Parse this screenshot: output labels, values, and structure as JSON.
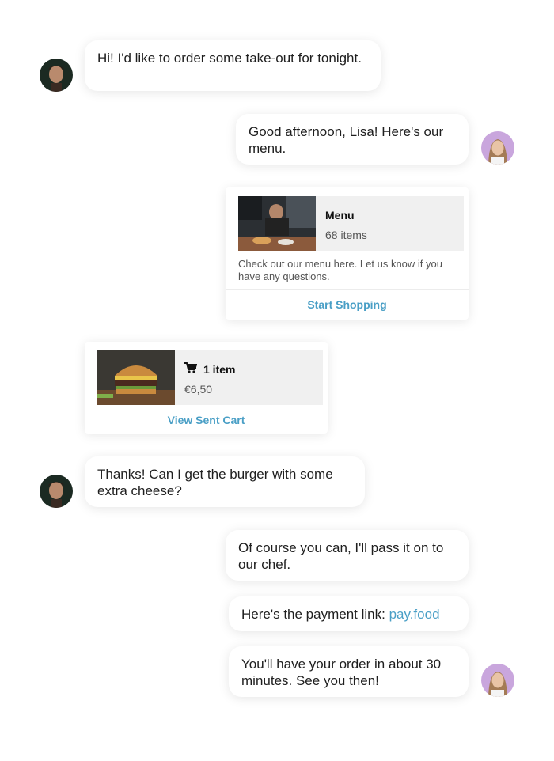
{
  "messages": {
    "m1": "Hi! I'd like to order some take-out for tonight.",
    "m2": "Good afternoon, Lisa! Here's our menu.",
    "m5": "Thanks! Can I get the burger with some extra cheese?",
    "m6": "Of course you can, I'll pass it on to our chef.",
    "m7_prefix": "Here's the payment link: ",
    "m7_link": "pay.food",
    "m8": "You'll have your order in about 30 minutes. See you then!"
  },
  "menu_card": {
    "title": "Menu",
    "count": "68 items",
    "description": "Check out our menu here. Let us know if you have any questions.",
    "cta": "Start Shopping"
  },
  "cart_card": {
    "icon": "cart-icon",
    "title": "1 item",
    "price": "€6,50",
    "cta": "View Sent Cart"
  },
  "colors": {
    "link": "#4a9fc6",
    "bubble_bg": "#ffffff",
    "thumb_bg": "#f0f0f0",
    "customer_avatar_bg": "#1b2a22",
    "agent_avatar_bg": "#c9a6dd"
  },
  "icons": {
    "customer_avatar": "customer-avatar",
    "agent_avatar": "agent-avatar",
    "menu_thumbnail": "kitchen-photo",
    "cart_thumbnail": "burger-photo"
  }
}
